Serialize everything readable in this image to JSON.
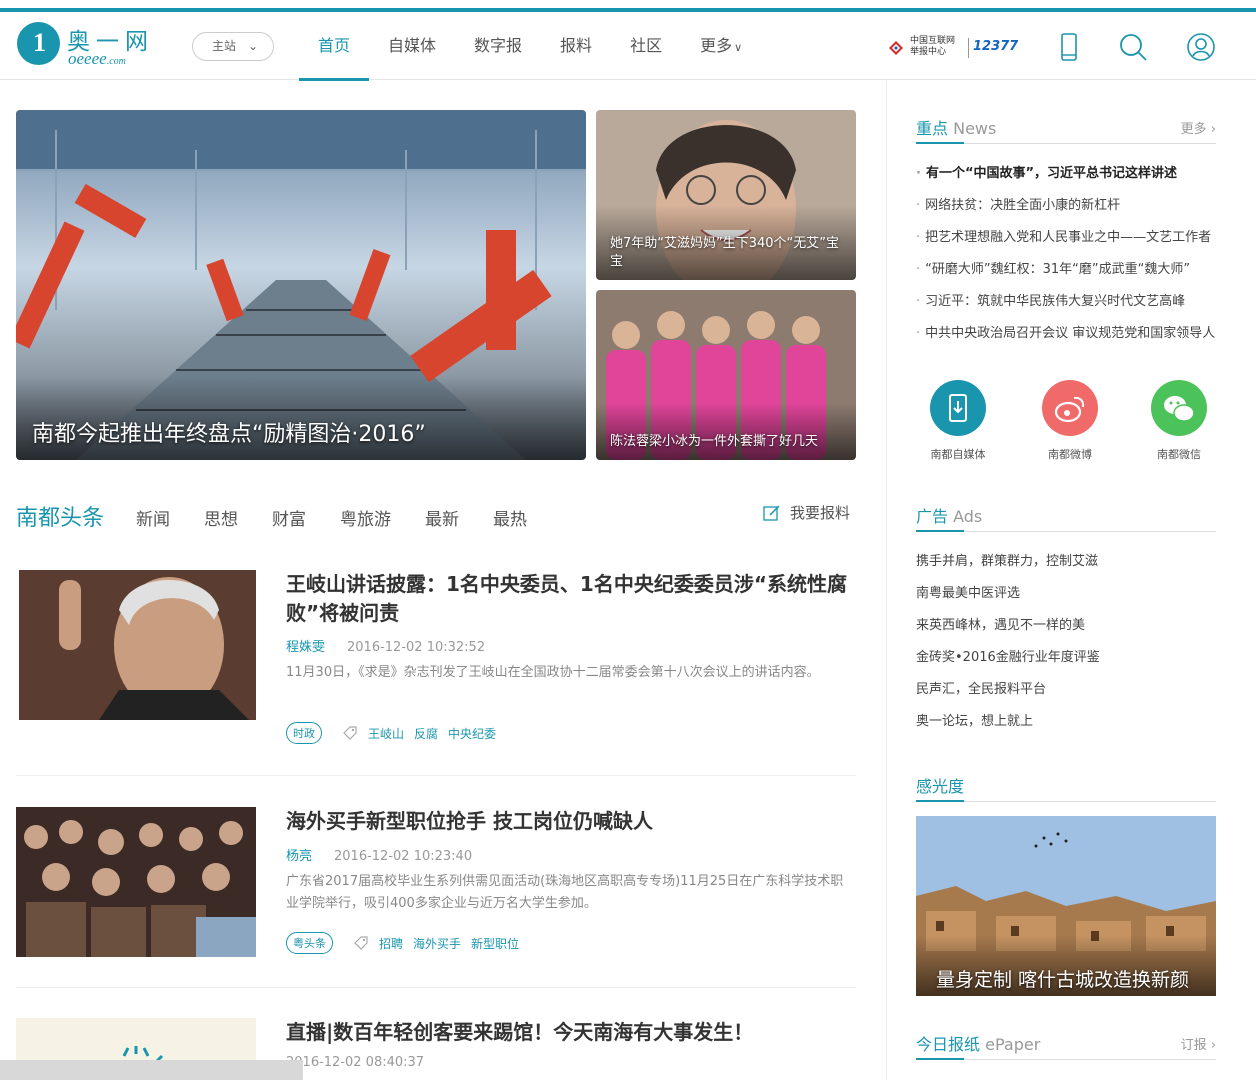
{
  "header": {
    "logo_cn": "奥一网",
    "logo_en": "oeeee",
    "logo_en_suffix": ".com",
    "site_select": "主站",
    "nav": [
      "首页",
      "自媒体",
      "数字报",
      "报料",
      "社区",
      "更多"
    ],
    "report_center_line1": "中国互联网",
    "report_center_line2": "举报中心",
    "report_number": "12377"
  },
  "hero": {
    "main_caption": "南都今起推出年终盘点“励精图治·2016”",
    "side1_caption": "她7年助“艾滋妈妈”生下340个“无艾”宝宝",
    "side2_caption": "陈法蓉梁小冰为一件外套撕了好几天"
  },
  "tabs": {
    "main": "南都头条",
    "items": [
      "新闻",
      "思想",
      "财富",
      "粤旅游",
      "最新",
      "最热"
    ],
    "report_btn": "我要报料"
  },
  "articles": [
    {
      "title": "王岐山讲话披露：1名中央委员、1名中央纪委委员涉“系统性腐败”将被问责",
      "author": "程姝雯",
      "time": "2016-12-02 10:32:52",
      "desc": "11月30日，《求是》杂志刊发了王岐山在全国政协十二届常委会第十八次会议上的讲话内容。",
      "badge": "时政",
      "tags": [
        "王岐山",
        "反腐",
        "中央纪委"
      ]
    },
    {
      "title": "海外买手新型职位抢手 技工岗位仍喊缺人",
      "author": "杨亮",
      "time": "2016-12-02 10:23:40",
      "desc": "广东省2017届高校毕业生系列供需见面活动(珠海地区高职高专专场)11月25日在广东科学技术职业学院举行，吸引400多家企业与近万名大学生参加。",
      "badge": "粤头条",
      "tags": [
        "招聘",
        "海外买手",
        "新型职位"
      ]
    },
    {
      "title": "直播|数百年轻创客要来踢馆！今天南海有大事发生！",
      "time": "2016-12-02 08:40:37"
    }
  ],
  "sidebar": {
    "news_title": "重点",
    "news_title_en": "News",
    "more": "更多",
    "news": [
      "有一个“中国故事”，习近平总书记这样讲述",
      "网络扶贫：决胜全面小康的新杠杆",
      "把艺术理想融入党和人民事业之中——文艺工作者",
      "“研磨大师”魏红权：31年“磨”成武重“魏大师”",
      "习近平：筑就中华民族伟大复兴时代文艺高峰",
      "中共中央政治局召开会议 审议规范党和国家领导人"
    ],
    "social": [
      "南都自媒体",
      "南都微博",
      "南都微信"
    ],
    "ads_title": "广告",
    "ads_title_en": "Ads",
    "ads": [
      "携手并肩，群策群力，控制艾滋",
      "南粤最美中医评选",
      "来英西峰林，遇见不一样的美",
      "金砖奖•2016金融行业年度评鉴",
      "民声汇，全民报料平台",
      "奥一论坛，想上就上"
    ],
    "gg_title": "感光度",
    "gg_caption": "量身定制 喀什古城改造换新颜",
    "epaper_title": "今日报纸",
    "epaper_title_en": "ePaper",
    "epaper_more": "订报"
  },
  "colors": {
    "accent": "#1a95ae",
    "weibo": "#f06a6a",
    "wechat": "#4cc25a"
  }
}
